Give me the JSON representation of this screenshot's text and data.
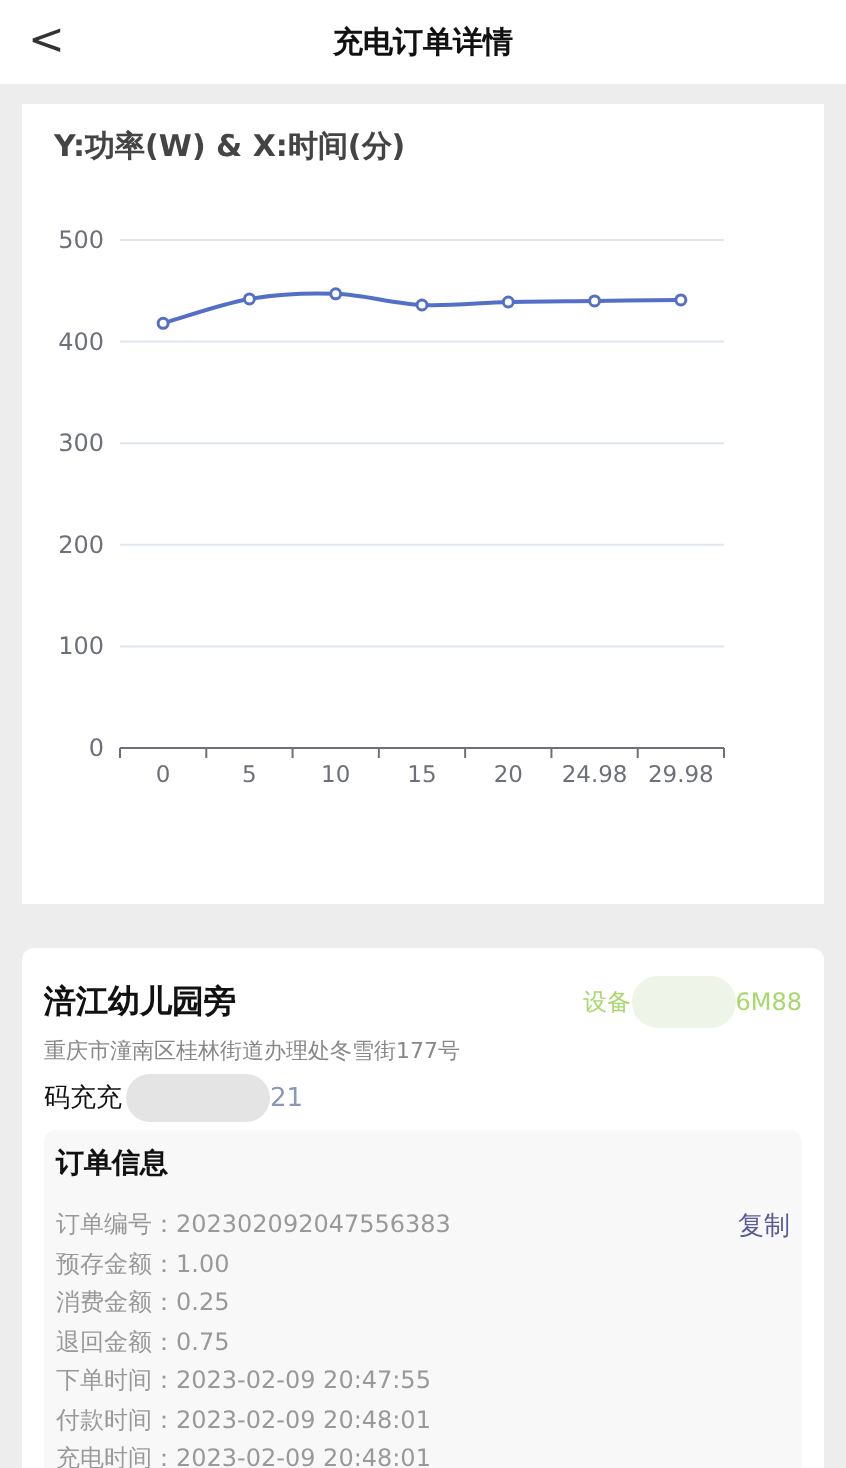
{
  "header": {
    "back_icon": "<",
    "title": "充电订单详情"
  },
  "chart": {
    "chart_data": {
      "type": "line",
      "title": "Y:功率(W) & X:时间(分)",
      "categories": [
        "0",
        "5",
        "10",
        "15",
        "20",
        "24.98",
        "29.98"
      ],
      "series": [
        {
          "color": "#5470c6",
          "marker": true,
          "values": [
            418,
            442,
            447,
            436,
            439,
            440,
            441
          ]
        }
      ],
      "grid": true,
      "ylim": [
        0,
        500
      ],
      "yticks": [
        0,
        100,
        200,
        300,
        400,
        500
      ]
    }
  },
  "station": {
    "name": "涪江幼儿园旁",
    "device_prefix": "设备",
    "device_suffix": "6M88",
    "address": "重庆市潼南区桂林街道办理处冬雪街177号",
    "contact_prefix": "码充充",
    "contact_suffix": "21"
  },
  "order_info": {
    "title": "订单信息",
    "copy_label": "复制",
    "rows": [
      {
        "label": "订单编号：",
        "value": "202302092047556383"
      },
      {
        "label": "预存金额：",
        "value": "1.00"
      },
      {
        "label": "消费金额：",
        "value": "0.25"
      },
      {
        "label": "退回金额：",
        "value": "0.75"
      },
      {
        "label": "下单时间：",
        "value": "2023-02-09 20:47:55"
      },
      {
        "label": "付款时间：",
        "value": "2023-02-09 20:48:01"
      },
      {
        "label": "充电时间：",
        "value": "2023-02-09 20:48:01"
      }
    ]
  }
}
